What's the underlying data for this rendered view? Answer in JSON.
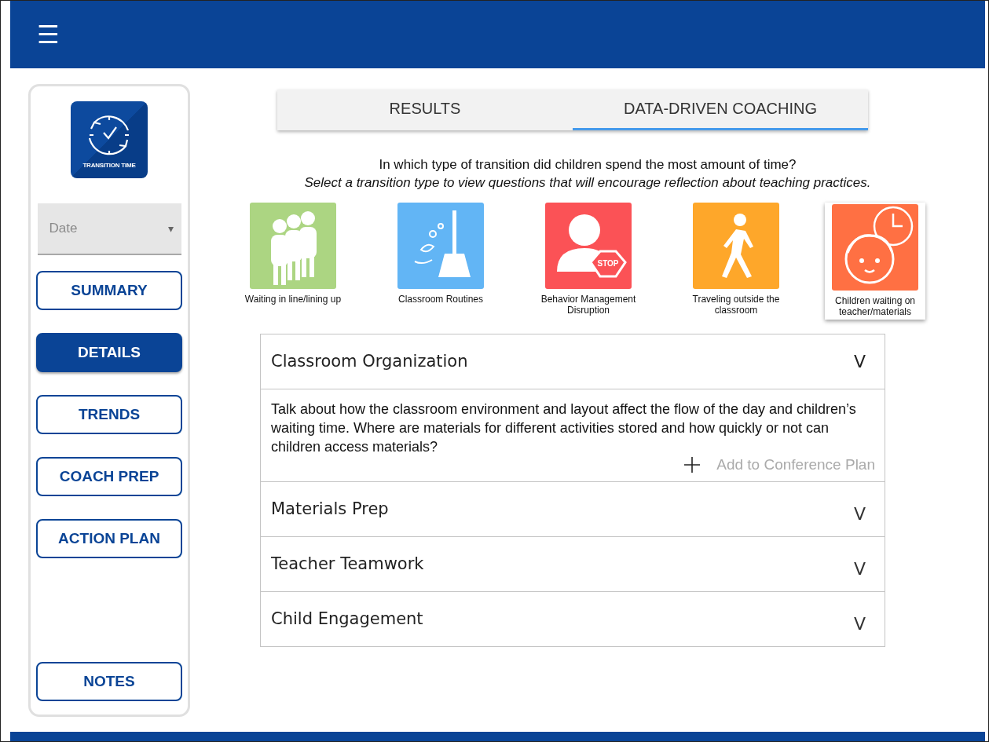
{
  "menu_glyph": "☰",
  "logo": {
    "caption": "TRANSITION TIME"
  },
  "date_select": {
    "placeholder": "Date",
    "caret": "▾"
  },
  "nav": [
    {
      "label": "SUMMARY",
      "selected": false
    },
    {
      "label": "DETAILS",
      "selected": true
    },
    {
      "label": "TRENDS",
      "selected": false
    },
    {
      "label": "COACH PREP",
      "selected": false
    },
    {
      "label": "ACTION PLAN",
      "selected": false
    },
    {
      "label": "NOTES",
      "selected": false
    }
  ],
  "tabs": [
    {
      "label": "RESULTS",
      "selected": false
    },
    {
      "label": "DATA-DRIVEN COACHING",
      "selected": true
    }
  ],
  "question": "In which type of transition did children spend the most amount of time?",
  "instruction": "Select a transition type to view questions that will encourage reflection about teaching practices.",
  "transition_types": [
    {
      "kind": "line",
      "label": "Waiting in line/lining up",
      "color": "#acd582",
      "selected": false
    },
    {
      "kind": "routines",
      "label": "Classroom Routines",
      "color": "#62b5f5",
      "selected": false
    },
    {
      "kind": "behavior",
      "label": "Behavior Management Disruption",
      "color": "#fb5256",
      "selected": false,
      "sign": "STOP"
    },
    {
      "kind": "traveling",
      "label": "Traveling outside the classroom",
      "color": "#fea72a",
      "selected": false
    },
    {
      "kind": "waiting",
      "label": "Children waiting on teacher/materials",
      "color": "#ff7043",
      "selected": true
    }
  ],
  "accordion": [
    {
      "title": "Classroom Organization",
      "toggle": "V",
      "expanded": true,
      "body": "Talk about how the classroom environment and layout affect the flow of the day and children’s waiting time. Where are materials for different activities stored and how quickly or not can children access materials?",
      "action": "Add to Conference Plan"
    },
    {
      "title": "Materials Prep",
      "toggle": "V",
      "expanded": false
    },
    {
      "title": "Teacher Teamwork",
      "toggle": "V",
      "expanded": false
    },
    {
      "title": "Child Engagement",
      "toggle": "V",
      "expanded": false
    }
  ]
}
